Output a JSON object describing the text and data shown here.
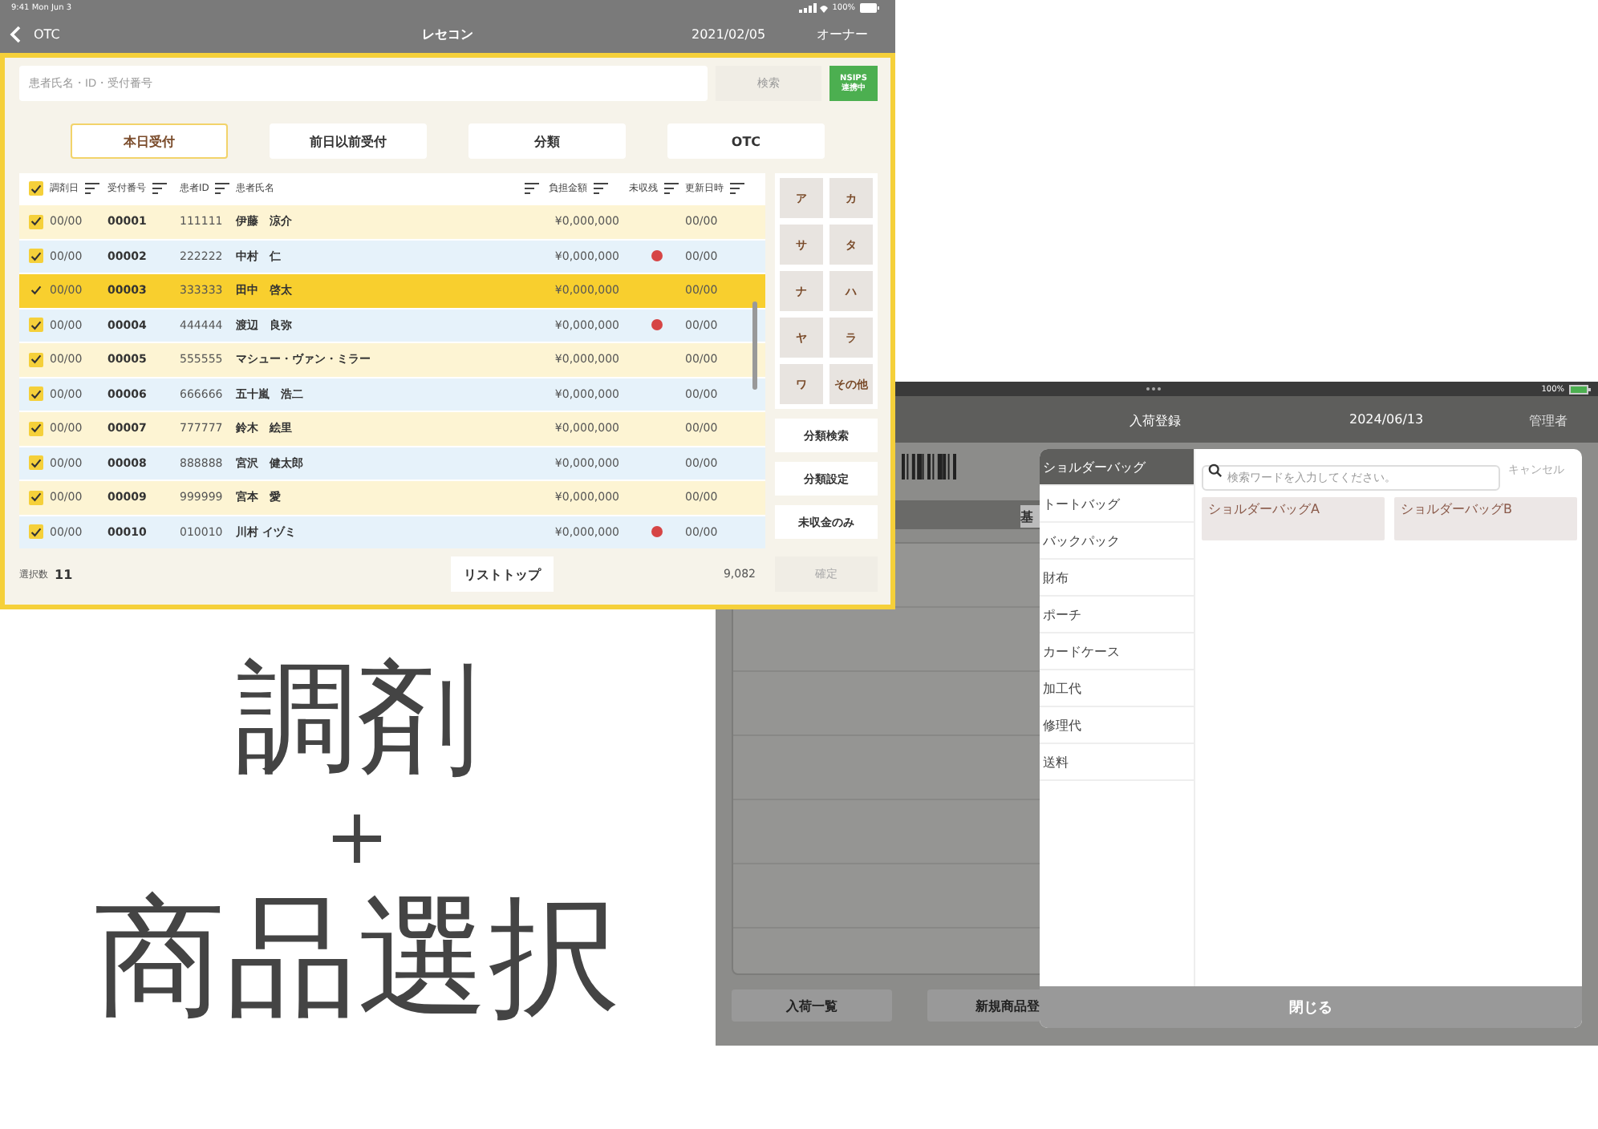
{
  "left_screen": {
    "status_bar": {
      "time": "9:41 Mon Jun 3",
      "battery": "100%"
    },
    "nav": {
      "back": "OTC",
      "title": "レセコン",
      "date": "2021/02/05",
      "user": "オーナー"
    },
    "search": {
      "placeholder": "患者氏名・ID・受付番号",
      "button": "検索",
      "badge_lines": [
        "NSIPS",
        "連携中"
      ]
    },
    "tabs": [
      {
        "label": "本日受付",
        "selected": true
      },
      {
        "label": "前日以前受付",
        "selected": false
      },
      {
        "label": "分類",
        "selected": false
      },
      {
        "label": "OTC",
        "selected": false
      }
    ],
    "table": {
      "all_checked": true,
      "columns": [
        "調剤日",
        "受付番号",
        "患者ID",
        "患者氏名",
        "負担金額",
        "未収残",
        "更新日時"
      ],
      "rows": [
        {
          "checked": true,
          "selected": false,
          "date": "00/00",
          "number": "00001",
          "id": "111111",
          "name": "伊藤　涼介",
          "amount": "¥0,000,000",
          "unpaid": false,
          "updated": "00/00"
        },
        {
          "checked": true,
          "selected": false,
          "date": "00/00",
          "number": "00002",
          "id": "222222",
          "name": "中村　仁",
          "amount": "¥0,000,000",
          "unpaid": true,
          "updated": "00/00"
        },
        {
          "checked": true,
          "selected": true,
          "date": "00/00",
          "number": "00003",
          "id": "333333",
          "name": "田中　啓太",
          "amount": "¥0,000,000",
          "unpaid": false,
          "updated": "00/00"
        },
        {
          "checked": true,
          "selected": false,
          "date": "00/00",
          "number": "00004",
          "id": "444444",
          "name": "渡辺　良弥",
          "amount": "¥0,000,000",
          "unpaid": true,
          "updated": "00/00"
        },
        {
          "checked": true,
          "selected": false,
          "date": "00/00",
          "number": "00005",
          "id": "555555",
          "name": "マシュー・ヴァン・ミラー",
          "amount": "¥0,000,000",
          "unpaid": false,
          "updated": "00/00"
        },
        {
          "checked": true,
          "selected": false,
          "date": "00/00",
          "number": "00006",
          "id": "666666",
          "name": "五十嵐　浩二",
          "amount": "¥0,000,000",
          "unpaid": false,
          "updated": "00/00"
        },
        {
          "checked": true,
          "selected": false,
          "date": "00/00",
          "number": "00007",
          "id": "777777",
          "name": "鈴木　絵里",
          "amount": "¥0,000,000",
          "unpaid": false,
          "updated": "00/00"
        },
        {
          "checked": true,
          "selected": false,
          "date": "00/00",
          "number": "00008",
          "id": "888888",
          "name": "宮沢　健太郎",
          "amount": "¥0,000,000",
          "unpaid": false,
          "updated": "00/00"
        },
        {
          "checked": true,
          "selected": false,
          "date": "00/00",
          "number": "00009",
          "id": "999999",
          "name": "宮本　愛",
          "amount": "¥0,000,000",
          "unpaid": false,
          "updated": "00/00"
        },
        {
          "checked": true,
          "selected": false,
          "date": "00/00",
          "number": "00010",
          "id": "010010",
          "name": "川村 イヅミ",
          "amount": "¥0,000,000",
          "unpaid": true,
          "updated": "00/00"
        }
      ]
    },
    "kana": [
      "ア",
      "カ",
      "サ",
      "タ",
      "ナ",
      "ハ",
      "ヤ",
      "ラ",
      "ワ",
      "その他"
    ],
    "side_buttons": [
      "分類検索",
      "分類設定",
      "未収金のみ"
    ],
    "footer": {
      "count_label": "選択数",
      "count": "11",
      "list_top": "リストトップ",
      "total": "9,082",
      "confirm": {
        "label": "確定",
        "disabled": true
      }
    }
  },
  "right_screen": {
    "status_bar": {
      "battery": "100%"
    },
    "nav": {
      "title": "入荷登録",
      "date": "2024/06/13",
      "user": "管理者"
    },
    "background_chip": "基",
    "bottom_buttons": [
      "入荷一覧",
      "新規商品登"
    ],
    "modal": {
      "categories": [
        {
          "label": "ショルダーバッグ",
          "selected": true
        },
        {
          "label": "トートバッグ",
          "selected": false
        },
        {
          "label": "バックパック",
          "selected": false
        },
        {
          "label": "財布",
          "selected": false
        },
        {
          "label": "ポーチ",
          "selected": false
        },
        {
          "label": "カードケース",
          "selected": false
        },
        {
          "label": "加工代",
          "selected": false
        },
        {
          "label": "修理代",
          "selected": false
        },
        {
          "label": "送料",
          "selected": false
        }
      ],
      "search": {
        "placeholder": "検索ワードを入力してください。"
      },
      "cancel": "キャンセル",
      "products": [
        "ショルダーバッグA",
        "ショルダーバッグB"
      ],
      "close": "閉じる"
    }
  },
  "caption": {
    "line1": "調剤",
    "plus": "+",
    "line2": "商品選択"
  }
}
